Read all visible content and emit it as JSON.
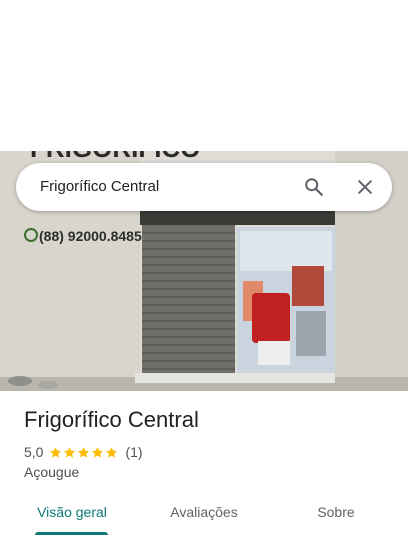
{
  "search": {
    "query": "Frigorífico Central",
    "search_icon": "search-icon",
    "close_icon": "close-icon"
  },
  "photo": {
    "sign_partial": "FRIGORÍFICO",
    "phone": "(88) 92000.8485",
    "phone_icon": "whatsapp-icon"
  },
  "place": {
    "name": "Frigorífico Central",
    "rating": "5,0",
    "stars": 5,
    "review_count": "(1)",
    "category": "Açougue"
  },
  "tabs": [
    {
      "label": "Visão geral",
      "active": true
    },
    {
      "label": "Avaliações",
      "active": false
    },
    {
      "label": "Sobre",
      "active": false
    }
  ],
  "colors": {
    "accent": "#0b7a75",
    "star": "#fbbc04",
    "text_primary": "#202124",
    "text_secondary": "#4d5156"
  }
}
